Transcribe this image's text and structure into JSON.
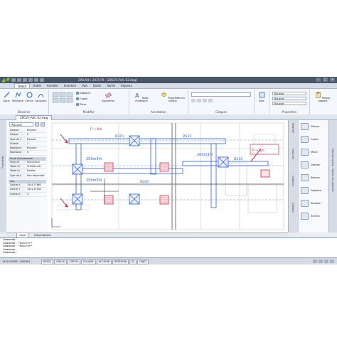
{
  "window": {
    "title": "ZWCAD+ 2015 FR - [ZRCVC-RdC-02.dwg]",
    "controls": [
      "–",
      "▢",
      "✕"
    ]
  },
  "tabs": [
    "Début",
    "Outils",
    "Annoter",
    "Insertion",
    "Vue",
    "Outils",
    "Sortie",
    "Express"
  ],
  "active_tab": 0,
  "ribbon": {
    "dessiner": {
      "group_label": "Dessiner",
      "buttons": [
        "Ligne",
        "Polyligne",
        "Cercle",
        "Longueur"
      ]
    },
    "modifier": {
      "group_label": "Modifier",
      "buttons": [
        "Déplacer",
        "Copier",
        "Étirer",
        "Supprimer"
      ]
    },
    "annotation": {
      "group_label": "Annotation",
      "buttons": [
        "Texte multiligne",
        "Propriétés du calque"
      ]
    },
    "calques": {
      "group_label": "Calques"
    },
    "proprietes": {
      "group_label": "Propriétés",
      "rows": [
        "ByLayer",
        "ByLayer",
        "ByLayer"
      ]
    },
    "bloc": {
      "label": "Bloc"
    },
    "clipboard": {
      "label": "Presse-papiers"
    }
  },
  "document_tab": "ZRCVC-RdC-02.dwg",
  "left_strip_label": "Propriétés",
  "properties": {
    "selector": "Aucune",
    "general": [
      {
        "k": "Couleur",
        "v": "ByLayer"
      },
      {
        "k": "Calque",
        "v": "0"
      },
      {
        "k": "Type de l.",
        "v": "ByLayer"
      },
      {
        "k": "Échelle",
        "v": "1"
      },
      {
        "k": "Épaisseur",
        "v": "ByLayer"
      },
      {
        "k": "Épaisseur",
        "v": "0"
      }
    ],
    "style_header": "Style d'impression",
    "style": [
      {
        "k": "Style d'i.",
        "v": "ParCouleur"
      },
      {
        "k": "Table d'i.",
        "v": "CHEVAL.ctb"
      },
      {
        "k": "Table d'i.",
        "v": "Modèle"
      },
      {
        "k": "Type de t.",
        "v": "Non disponible"
      }
    ],
    "view_header": "Vue",
    "view": [
      {
        "k": "Centre X",
        "v": "1444.77665"
      },
      {
        "k": "Centre Y",
        "v": "1441.27945"
      },
      {
        "k": "Centre Z",
        "v": "0"
      }
    ]
  },
  "canvas_labels": {
    "flow_1": "250m3/h",
    "flow_2": "250m3/h",
    "flow_3": "200m3/h",
    "dia_1": "Ø315",
    "dia_2": "Ø315",
    "dia_3": "Ø315",
    "dia_4": "Ø200",
    "p_top": "P → 6m",
    "p_right": "P → 6m"
  },
  "right_strip": [
    "Modifier",
    "Dessiner",
    "Cotation",
    "Calques"
  ],
  "tools": [
    "Effacer",
    "Copier",
    "Miroir",
    "Décaler",
    "Réseau",
    "Déplacer",
    "Rotation",
    "Échelle"
  ],
  "palette_strip_label": "Palettes outils - Toutes les palettes",
  "layout_tabs": [
    "Objet",
    "Présentation1"
  ],
  "command_lines": [
    "Commande:",
    "Commande: *Annuler*",
    "Commande: *Annuler*",
    "Commande:",
    "Commande:"
  ],
  "status": {
    "coords": "1445.50565, 1.80764",
    "modes": [
      "RESOL",
      "GRILLE",
      "ORTHO",
      "POLAIRE",
      "ACCROBJ",
      "REPEROBJ",
      "EL",
      "OBJET"
    ]
  }
}
